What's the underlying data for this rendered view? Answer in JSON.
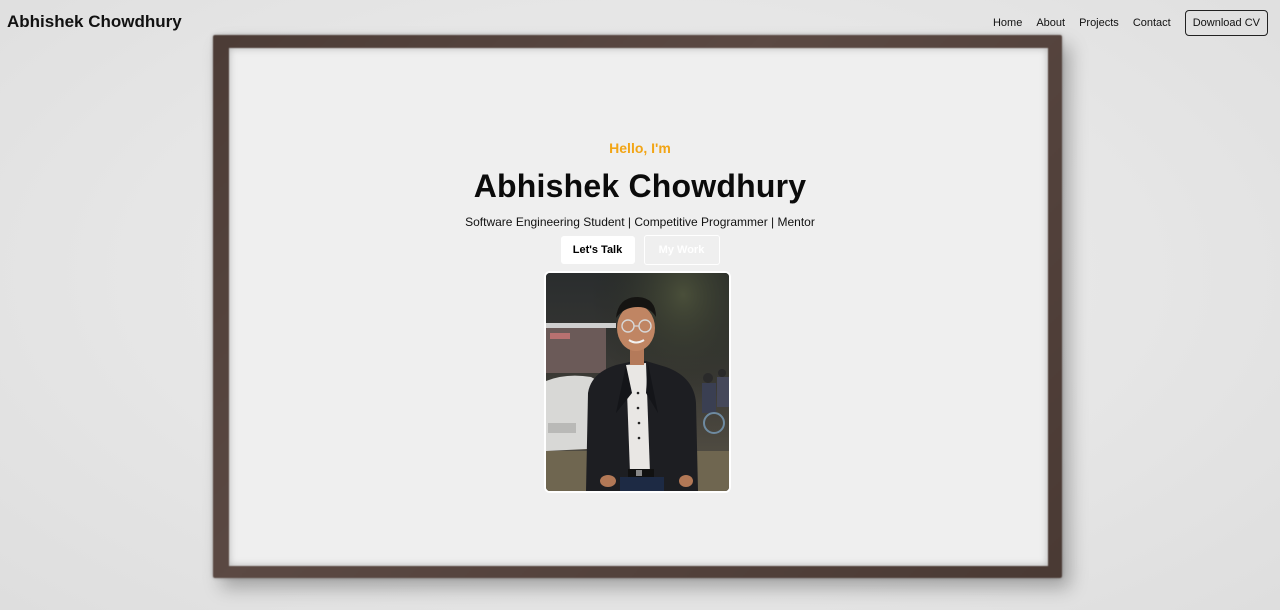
{
  "nav": {
    "brand": "Abhishek Chowdhury",
    "links": [
      "Home",
      "About",
      "Projects",
      "Contact"
    ],
    "cv_button": "Download CV"
  },
  "hero": {
    "greeting": "Hello, I'm",
    "name": "Abhishek Chowdhury",
    "tagline": "Software Engineering Student | Competitive Programmer | Mentor",
    "primary_button": "Let's Talk",
    "secondary_button": "My Work"
  },
  "colors": {
    "accent": "#f2a516",
    "frame": "#4c3c36",
    "background": "#e6e6e6"
  },
  "icons": {
    "profile_photo": "profile-photo"
  }
}
